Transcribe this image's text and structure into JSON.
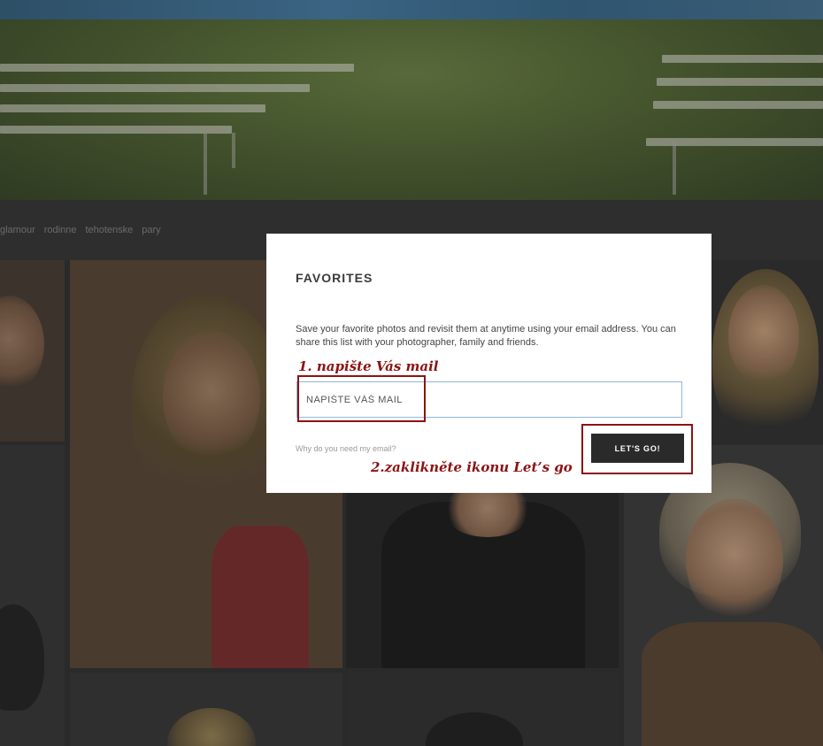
{
  "categories": [
    "glamour",
    "rodinne",
    "tehotenske",
    "pary"
  ],
  "modal": {
    "title": "FAVORITES",
    "description": "Save your favorite photos and revisit them at anytime using your email address. You can share this list with your photographer, family and friends.",
    "email_placeholder": "NAPIŠTE VÁŠ MAIL",
    "email_value": "",
    "why_link": "Why do you need my email?",
    "submit_label": "LET'S GO!"
  },
  "annotations": {
    "step1": "1. napište Vás mail",
    "step2": "2.zaklikněte ikonu Let’s go",
    "color": "#8b1313"
  },
  "colors": {
    "backdrop": "#2a2a2a",
    "button_bg": "#2a2a2a",
    "input_border": "#8fb8d6",
    "highlight": "#8b1313"
  }
}
